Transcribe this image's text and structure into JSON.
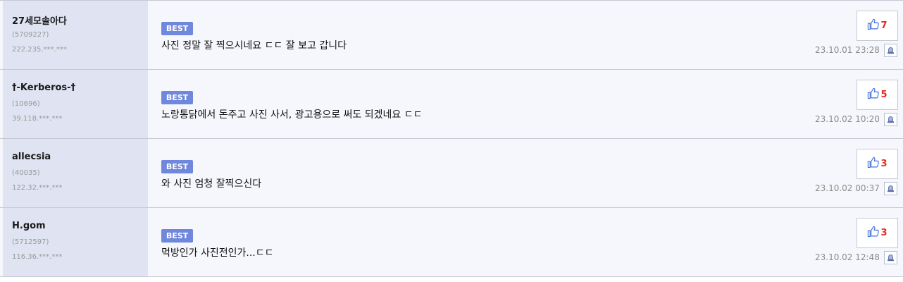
{
  "badge_label": "BEST",
  "colors": {
    "like_count": "#e52a1c",
    "badge_bg": "#6f87dc",
    "left_bg": "#dfe3f2"
  },
  "icons": {
    "like": "thumbs-up-icon",
    "report": "siren-icon"
  },
  "comments": [
    {
      "nickname": "27세모솔아다",
      "user_id": "(5709227)",
      "ip": "222.235.***.***",
      "text": "사진 정말 잘 찍으시네요 ㄷㄷ 잘 보고 갑니다",
      "likes": "7",
      "date": "23.10.01 23:28"
    },
    {
      "nickname": "†-Kerberos-†",
      "user_id": "(10696)",
      "ip": "39.118.***.***",
      "text": "노랑통닭에서 돈주고 사진 사서, 광고용으로 써도 되겠네요 ㄷㄷ",
      "likes": "5",
      "date": "23.10.02 10:20"
    },
    {
      "nickname": "allecsia",
      "user_id": "(40035)",
      "ip": "122.32.***.***",
      "text": "와 사진 엄청 잘찍으신다",
      "likes": "3",
      "date": "23.10.02 00:37"
    },
    {
      "nickname": "H.gom",
      "user_id": "(5712597)",
      "ip": "116.36.***.***",
      "text": "먹방인가 사진전인가...ㄷㄷ",
      "likes": "3",
      "date": "23.10.02 12:48"
    }
  ]
}
